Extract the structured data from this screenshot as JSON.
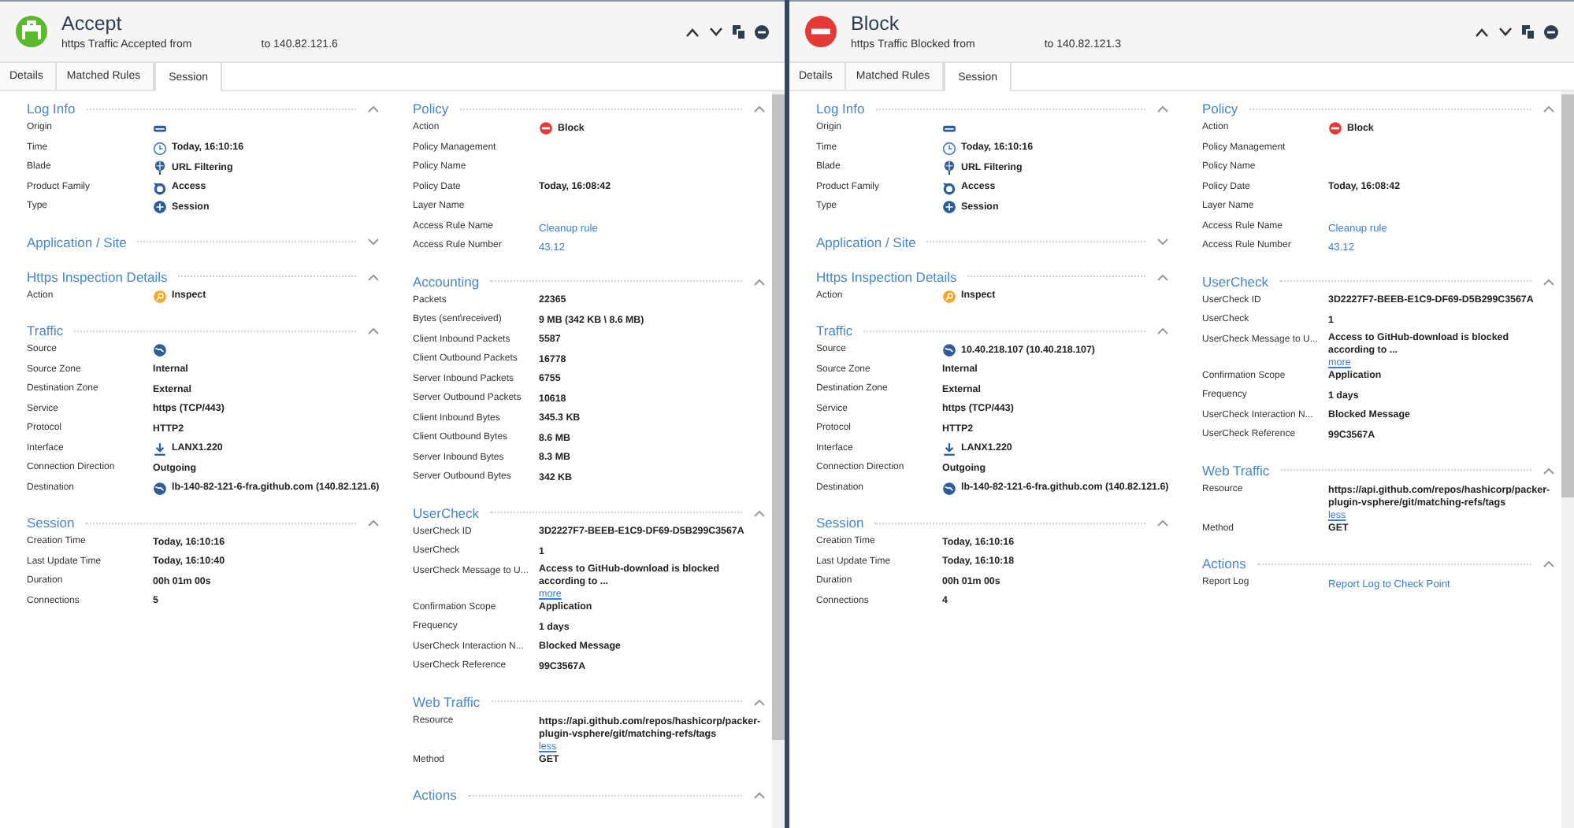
{
  "panes": [
    {
      "kind": "accept",
      "title": "Accept",
      "subtitle_from": "https Traffic Accepted from",
      "subtitle_to": "to 140.82.121.6",
      "tabs": [
        {
          "label": "Details",
          "selected": false
        },
        {
          "label": "Matched Rules",
          "selected": false
        },
        {
          "label": "Session",
          "selected": true
        }
      ],
      "columns": [
        [
          {
            "title": "Log Info",
            "expanded": true,
            "rows": [
              {
                "label": "Origin",
                "kind": "server"
              },
              {
                "label": "Time",
                "kind": "clock",
                "value": "Today, 16:10:16"
              },
              {
                "label": "Blade",
                "kind": "blade",
                "value": "URL Filtering"
              },
              {
                "label": "Product Family",
                "kind": "family",
                "value": "Access"
              },
              {
                "label": "Type",
                "kind": "session",
                "value": "Session"
              }
            ]
          },
          {
            "title": "Application / Site",
            "expanded": false
          },
          {
            "title": "Https Inspection Details",
            "expanded": true,
            "rows": [
              {
                "label": "Action",
                "kind": "inspect",
                "value": "Inspect"
              }
            ]
          },
          {
            "title": "Traffic",
            "expanded": true,
            "rows": [
              {
                "label": "Source",
                "kind": "globe"
              },
              {
                "label": "Source Zone",
                "value": "Internal"
              },
              {
                "label": "Destination Zone",
                "value": "External"
              },
              {
                "label": "Service",
                "value": "https (TCP/443)"
              },
              {
                "label": "Protocol",
                "value": "HTTP2"
              },
              {
                "label": "Interface",
                "kind": "download",
                "value": "LANX1.220"
              },
              {
                "label": "Connection Direction",
                "value": "Outgoing"
              },
              {
                "label": "Destination",
                "kind": "globe",
                "value": "lb-140-82-121-6-fra.github.com (140.82.121.6)"
              }
            ]
          },
          {
            "title": "Session",
            "expanded": true,
            "rows": [
              {
                "label": "Creation Time",
                "value": "Today, 16:10:16"
              },
              {
                "label": "Last Update Time",
                "value": "Today, 16:10:40"
              },
              {
                "label": "Duration",
                "value": "00h 01m 00s"
              },
              {
                "label": "Connections",
                "value": "5"
              }
            ]
          }
        ],
        [
          {
            "title": "Policy",
            "expanded": true,
            "rows": [
              {
                "label": "Action",
                "kind": "block",
                "value": "Block"
              },
              {
                "label": "Policy Management"
              },
              {
                "label": "Policy Name"
              },
              {
                "label": "Policy Date",
                "value": "Today, 16:08:42"
              },
              {
                "label": "Layer Name"
              },
              {
                "label": "Access Rule Name",
                "link": "Cleanup rule"
              },
              {
                "label": "Access Rule Number",
                "link": "43.12"
              }
            ]
          },
          {
            "title": "Accounting",
            "expanded": true,
            "rows": [
              {
                "label": "Packets",
                "value": "22365"
              },
              {
                "label": "Bytes (sent\\received)",
                "value": "9 MB (342 KB \\ 8.6 MB)"
              },
              {
                "label": "Client Inbound Packets",
                "value": "5587"
              },
              {
                "label": "Client Outbound Packets",
                "value": "16778"
              },
              {
                "label": "Server Inbound Packets",
                "value": "6755"
              },
              {
                "label": "Server Outbound Packets",
                "value": "10618"
              },
              {
                "label": "Client Inbound Bytes",
                "value": "345.3 KB"
              },
              {
                "label": "Client Outbound Bytes",
                "value": "8.6 MB"
              },
              {
                "label": "Server Inbound Bytes",
                "value": "8.3 MB"
              },
              {
                "label": "Server Outbound Bytes",
                "value": "342 KB"
              }
            ]
          },
          {
            "title": "UserCheck",
            "expanded": true,
            "rows": [
              {
                "label": "UserCheck ID",
                "value": "3D2227F7-BEEB-E1C9-DF69-D5B299C3567A"
              },
              {
                "label": "UserCheck",
                "value": "1"
              },
              {
                "label": "UserCheck Message to U...",
                "value": "Access to GitHub-download is blocked according to ...",
                "toggle": "more"
              },
              {
                "label": "Confirmation Scope",
                "value": "Application"
              },
              {
                "label": "Frequency",
                "value": "1 days"
              },
              {
                "label": "UserCheck Interaction N...",
                "value": "Blocked Message"
              },
              {
                "label": "UserCheck Reference",
                "value": "99C3567A"
              }
            ]
          },
          {
            "title": "Web Traffic",
            "expanded": true,
            "rows": [
              {
                "label": "Resource",
                "value": "https://api.github.com/repos/hashicorp/packer-plugin-vsphere/git/matching-refs/tags",
                "toggle": "less"
              },
              {
                "label": "Method",
                "value": "GET"
              }
            ]
          },
          {
            "title": "Actions",
            "expanded": true
          }
        ]
      ]
    },
    {
      "kind": "block",
      "title": "Block",
      "subtitle_from": "https Traffic Blocked from",
      "subtitle_to": "to 140.82.121.3",
      "tabs": [
        {
          "label": "Details",
          "selected": false
        },
        {
          "label": "Matched Rules",
          "selected": false
        },
        {
          "label": "Session",
          "selected": true
        }
      ],
      "columns": [
        [
          {
            "title": "Log Info",
            "expanded": true,
            "rows": [
              {
                "label": "Origin",
                "kind": "server"
              },
              {
                "label": "Time",
                "kind": "clock",
                "value": "Today, 16:10:16"
              },
              {
                "label": "Blade",
                "kind": "blade",
                "value": "URL Filtering"
              },
              {
                "label": "Product Family",
                "kind": "family",
                "value": "Access"
              },
              {
                "label": "Type",
                "kind": "session",
                "value": "Session"
              }
            ]
          },
          {
            "title": "Application / Site",
            "expanded": false
          },
          {
            "title": "Https Inspection Details",
            "expanded": true,
            "rows": [
              {
                "label": "Action",
                "kind": "inspect",
                "value": "Inspect"
              }
            ]
          },
          {
            "title": "Traffic",
            "expanded": true,
            "rows": [
              {
                "label": "Source",
                "kind": "globe",
                "value": "10.40.218.107 (10.40.218.107)"
              },
              {
                "label": "Source Zone",
                "value": "Internal"
              },
              {
                "label": "Destination Zone",
                "value": "External"
              },
              {
                "label": "Service",
                "value": "https (TCP/443)"
              },
              {
                "label": "Protocol",
                "value": "HTTP2"
              },
              {
                "label": "Interface",
                "kind": "download",
                "value": "LANX1.220"
              },
              {
                "label": "Connection Direction",
                "value": "Outgoing"
              },
              {
                "label": "Destination",
                "kind": "globe",
                "value": "lb-140-82-121-6-fra.github.com (140.82.121.6)"
              }
            ]
          },
          {
            "title": "Session",
            "expanded": true,
            "rows": [
              {
                "label": "Creation Time",
                "value": "Today, 16:10:16"
              },
              {
                "label": "Last Update Time",
                "value": "Today, 16:10:18"
              },
              {
                "label": "Duration",
                "value": "00h 01m 00s"
              },
              {
                "label": "Connections",
                "value": "4"
              }
            ]
          }
        ],
        [
          {
            "title": "Policy",
            "expanded": true,
            "rows": [
              {
                "label": "Action",
                "kind": "block",
                "value": "Block"
              },
              {
                "label": "Policy Management"
              },
              {
                "label": "Policy Name"
              },
              {
                "label": "Policy Date",
                "value": "Today, 16:08:42"
              },
              {
                "label": "Layer Name"
              },
              {
                "label": "Access Rule Name",
                "link": "Cleanup rule"
              },
              {
                "label": "Access Rule Number",
                "link": "43.12"
              }
            ]
          },
          {
            "title": "UserCheck",
            "expanded": true,
            "rows": [
              {
                "label": "UserCheck ID",
                "value": "3D2227F7-BEEB-E1C9-DF69-D5B299C3567A"
              },
              {
                "label": "UserCheck",
                "value": "1"
              },
              {
                "label": "UserCheck Message to U...",
                "value": "Access to GitHub-download is blocked according to ...",
                "toggle": "more"
              },
              {
                "label": "Confirmation Scope",
                "value": "Application"
              },
              {
                "label": "Frequency",
                "value": "1 days"
              },
              {
                "label": "UserCheck Interaction N...",
                "value": "Blocked Message"
              },
              {
                "label": "UserCheck Reference",
                "value": "99C3567A"
              }
            ]
          },
          {
            "title": "Web Traffic",
            "expanded": true,
            "rows": [
              {
                "label": "Resource",
                "value": "https://api.github.com/repos/hashicorp/packer-plugin-vsphere/git/matching-refs/tags",
                "toggle": "less"
              },
              {
                "label": "Method",
                "value": "GET"
              }
            ]
          },
          {
            "title": "Actions",
            "expanded": true,
            "rows": [
              {
                "label": "Report Log",
                "link": "Report Log to Check Point"
              }
            ]
          }
        ]
      ]
    }
  ]
}
